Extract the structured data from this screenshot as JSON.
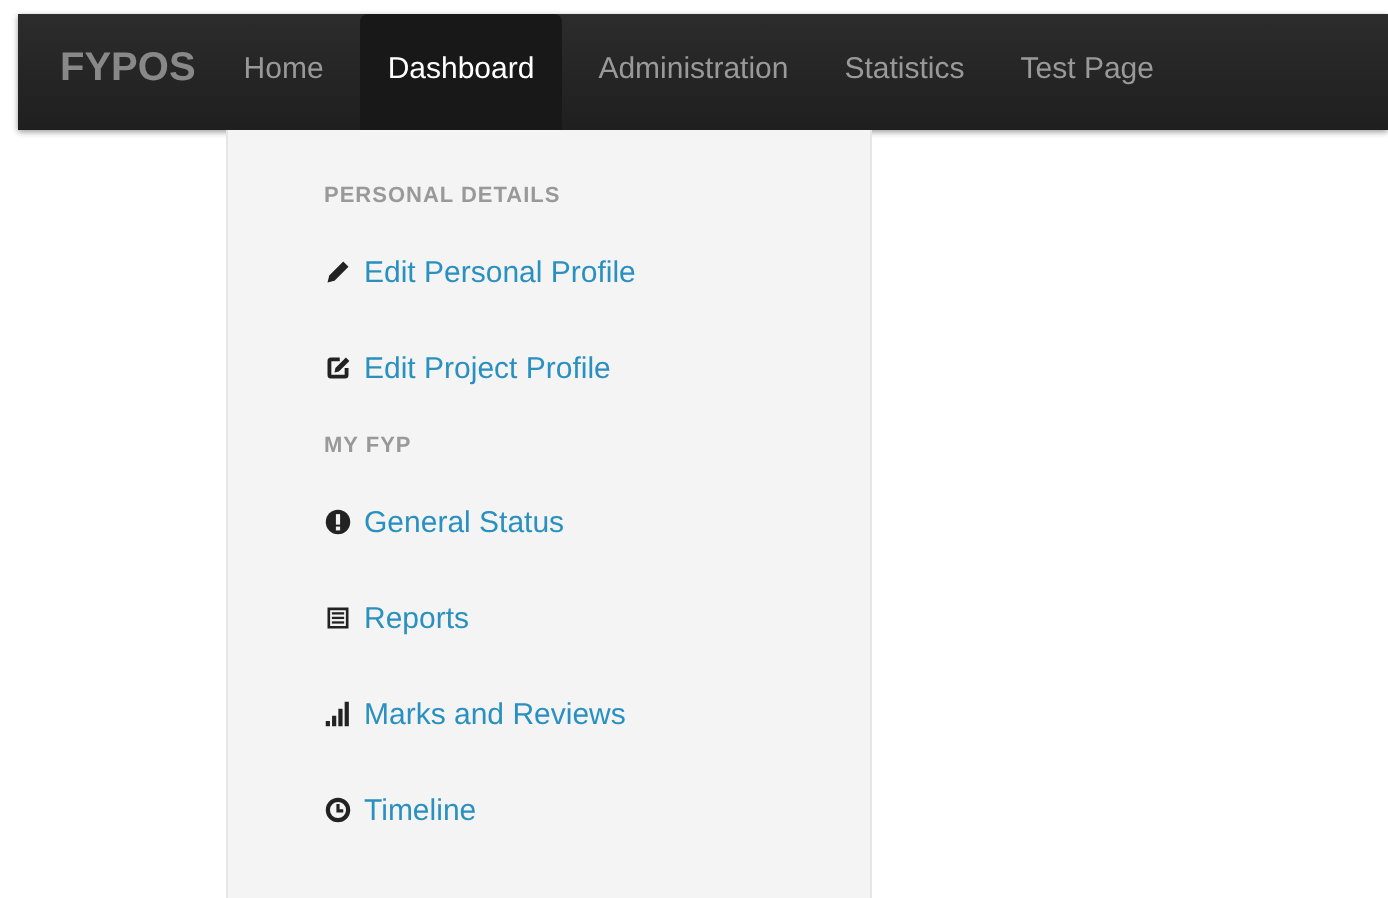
{
  "navbar": {
    "brand": "FYPOS",
    "tabs": [
      {
        "label": "Home",
        "selected": false
      },
      {
        "label": "Dashboard",
        "selected": true
      },
      {
        "label": "Administration",
        "selected": false
      },
      {
        "label": "Statistics",
        "selected": false
      },
      {
        "label": "Test Page",
        "selected": false
      }
    ]
  },
  "sidebar": {
    "sections": [
      {
        "title": "PERSONAL DETAILS",
        "items": [
          {
            "label": "Edit Personal Profile"
          },
          {
            "label": "Edit Project Profile"
          }
        ]
      },
      {
        "title": "MY FYP",
        "items": [
          {
            "label": "General Status"
          },
          {
            "label": "Reports"
          },
          {
            "label": "Marks and Reviews"
          },
          {
            "label": "Timeline"
          }
        ]
      }
    ]
  }
}
